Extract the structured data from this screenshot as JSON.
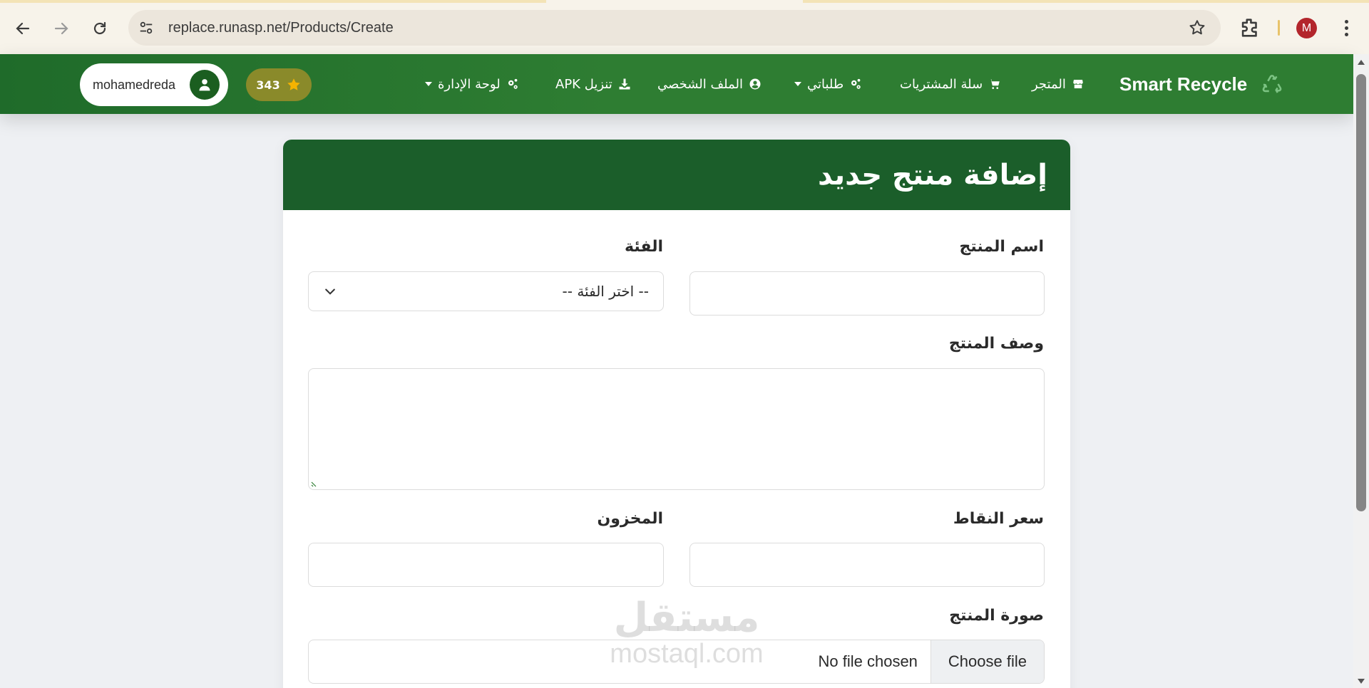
{
  "browser": {
    "url": "replace.runasp.net/Products/Create",
    "profile_initial": "M",
    "accent_color": "#b3262c"
  },
  "navbar": {
    "brand": "Smart Recycle",
    "items": [
      {
        "label": "المتجر",
        "icon": "store-icon"
      },
      {
        "label": "سلة المشتريات",
        "icon": "cart-icon"
      },
      {
        "label": "طلباتي",
        "icon": "gears-icon",
        "dropdown": true
      },
      {
        "label": "الملف الشخصي",
        "icon": "user-circle-icon"
      },
      {
        "label": "تنزيل APK",
        "icon": "download-icon"
      },
      {
        "label": "لوحة الإدارة",
        "icon": "gears-icon",
        "dropdown": true
      }
    ],
    "points": "343",
    "username": "mohamedreda",
    "colors": {
      "bar": "#2e7d32",
      "points_pill": "#8a8a2a",
      "star": "#f5b301"
    }
  },
  "form": {
    "title": "إضافة منتج جديد",
    "name_label": "اسم المنتج",
    "category_label": "الفئة",
    "category_selected": "-- اختر الفئة --",
    "description_label": "وصف المنتج",
    "price_label": "سعر النقاط",
    "stock_label": "المخزون",
    "image_label": "صورة المنتج",
    "file_button": "Choose file",
    "file_status": "No file chosen",
    "header_color": "#1b5e2a"
  },
  "watermark": {
    "arabic": "مستقل",
    "latin": "mostaql.com"
  }
}
